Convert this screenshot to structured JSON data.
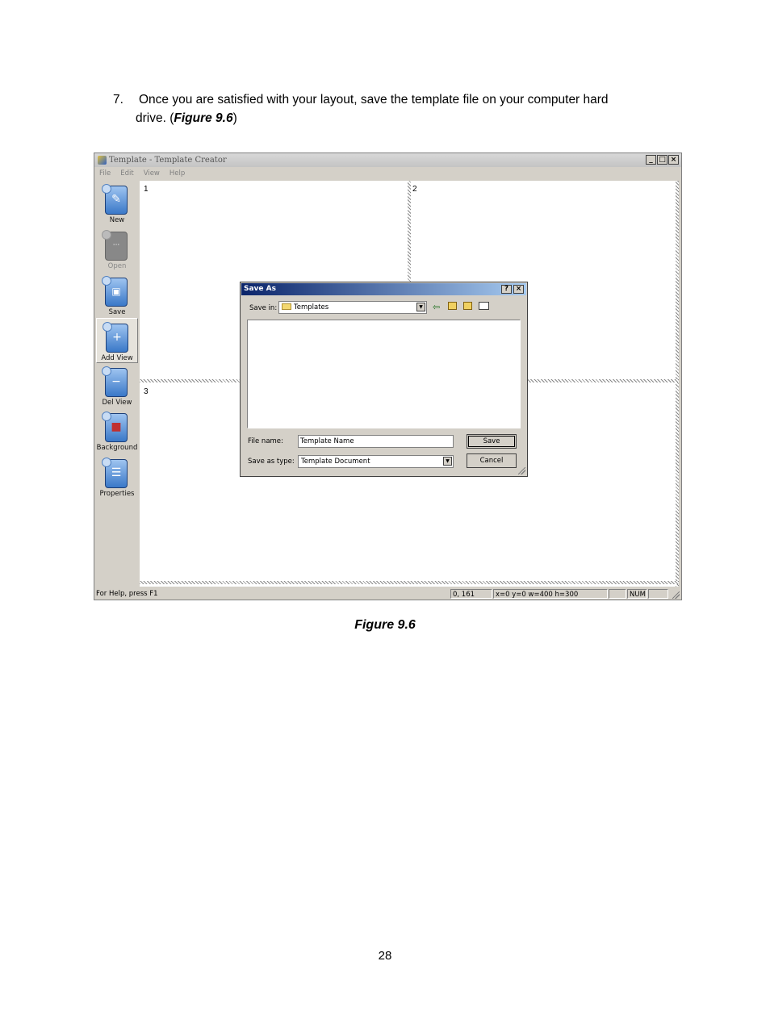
{
  "document": {
    "step_number": "7.",
    "step_text_line1": "Once you are satisfied with your layout, save the template file on your computer hard",
    "step_text_line2_prefix": "drive. (",
    "step_text_ref": "Figure 9.6",
    "step_text_line2_suffix": ")",
    "caption": "Figure 9.6",
    "page_number": "28"
  },
  "window": {
    "title": "Template - Template Creator",
    "buttons": [
      "_",
      "□",
      "×"
    ],
    "menu": [
      "File",
      "Edit",
      "View",
      "Help"
    ],
    "toolbar": [
      {
        "label": "New",
        "icon": "new-pen-icon",
        "enabled": true
      },
      {
        "label": "Open",
        "icon": "open-icon",
        "enabled": false
      },
      {
        "label": "Save",
        "icon": "save-disk-icon",
        "enabled": true
      },
      {
        "label": "Add View",
        "icon": "add-view-icon",
        "enabled": true
      },
      {
        "label": "Del View",
        "icon": "del-view-icon",
        "enabled": true
      },
      {
        "label": "Background",
        "icon": "background-icon",
        "enabled": true
      },
      {
        "label": "Properties",
        "icon": "properties-icon",
        "enabled": true
      }
    ],
    "views": [
      "1",
      "2",
      "3"
    ],
    "status": {
      "help": "For Help, press F1",
      "coords": "0, 161",
      "geometry": "x=0 y=0 w=400 h=300",
      "num": "NUM"
    }
  },
  "dialog": {
    "title": "Save As",
    "title_buttons": [
      "?",
      "×"
    ],
    "save_in_label": "Save in:",
    "save_in_value": "Templates",
    "file_name_label": "File name:",
    "file_name_value": "Template Name",
    "save_as_type_label": "Save as type:",
    "save_as_type_value": "Template Document",
    "save_button": "Save",
    "cancel_button": "Cancel"
  }
}
